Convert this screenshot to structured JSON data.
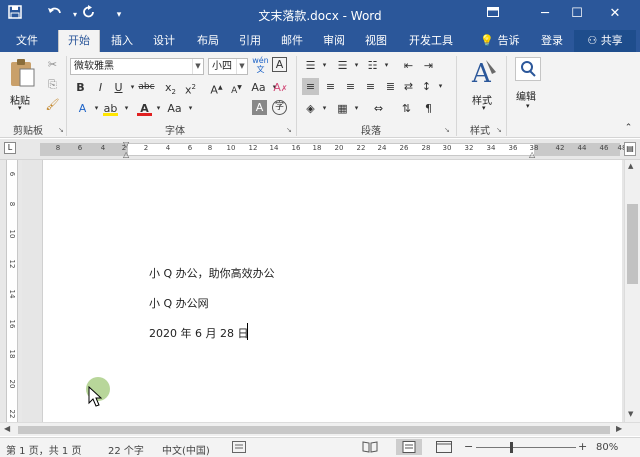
{
  "window": {
    "title": "文末落款.docx - Word"
  },
  "quick_access": {
    "save_icon": "save-icon",
    "undo_icon": "undo-icon",
    "redo_icon": "redo-icon"
  },
  "tabs": [
    {
      "label": "文件"
    },
    {
      "label": "开始"
    },
    {
      "label": "插入"
    },
    {
      "label": "设计"
    },
    {
      "label": "布局"
    },
    {
      "label": "引用"
    },
    {
      "label": "邮件"
    },
    {
      "label": "审阅"
    },
    {
      "label": "视图"
    },
    {
      "label": "开发工具"
    }
  ],
  "tell_me": "告诉我...",
  "signin": "登录",
  "share": "共享",
  "ribbon": {
    "clipboard": {
      "paste": "粘贴",
      "group": "剪贴板"
    },
    "font": {
      "name": "微软雅黑",
      "size": "小四",
      "wen": "wén",
      "group": "字体"
    },
    "paragraph": {
      "group": "段落"
    },
    "styles": {
      "label": "样式",
      "group": "样式"
    },
    "editing": {
      "label": "编辑"
    }
  },
  "ruler": {
    "h_ticks": [
      "8",
      "6",
      "4",
      "2",
      "2",
      "4",
      "6",
      "8",
      "10",
      "12",
      "14",
      "16",
      "18",
      "20",
      "22",
      "24",
      "26",
      "28",
      "30",
      "32",
      "34",
      "36",
      "38",
      "42",
      "44",
      "46",
      "48"
    ],
    "v_ticks": [
      "6",
      "8",
      "10",
      "12",
      "14",
      "16",
      "18",
      "20",
      "22"
    ],
    "corner": "L"
  },
  "document": {
    "lines": [
      "小 Q 办公，助你高效办公",
      "小 Q 办公网",
      "2020 年 6 月 28 日"
    ]
  },
  "status": {
    "page": "第 1 页，共 1 页",
    "words": "22 个字",
    "lang": "中文(中国)",
    "zoom": "80%"
  }
}
